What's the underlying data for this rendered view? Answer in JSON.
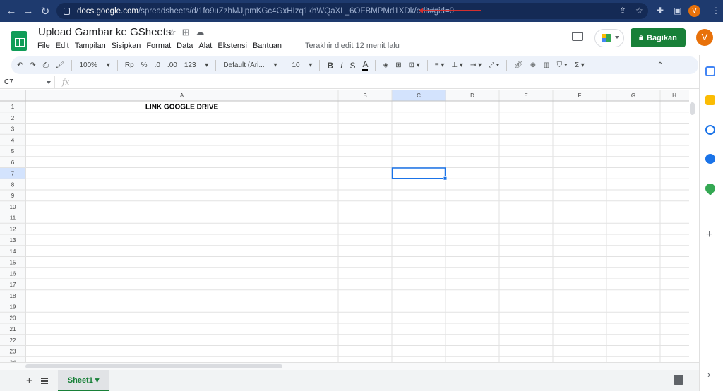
{
  "browser": {
    "url_host": "docs.google.com",
    "url_path": "/spreadsheets/d/1fo9uZzhMJjpmKGc4GxHIzq1khWQaXL_6OFBMPMd1XDk/edit#gid=0",
    "profile_initial": "V"
  },
  "doc": {
    "title": "Upload Gambar ke GSheets",
    "last_edit": "Terakhir diedit 12 menit lalu",
    "share_label": "Bagikan",
    "user_initial": "V"
  },
  "menu": [
    "File",
    "Edit",
    "Tampilan",
    "Sisipkan",
    "Format",
    "Data",
    "Alat",
    "Ekstensi",
    "Bantuan"
  ],
  "toolbar": {
    "zoom": "100%",
    "currency": "Rp",
    "percent": "%",
    "dec_decrease": ".0",
    "dec_increase": ".00",
    "more_formats": "123",
    "font": "Default (Ari...",
    "font_size": "10"
  },
  "formula_bar": {
    "cell_ref": "C7",
    "fx": "fx",
    "content": ""
  },
  "columns": [
    "A",
    "B",
    "C",
    "D",
    "E",
    "F",
    "G",
    "H"
  ],
  "rows": [
    "1",
    "2",
    "3",
    "4",
    "5",
    "6",
    "7",
    "8",
    "9",
    "10",
    "11",
    "12",
    "13",
    "14",
    "15",
    "16",
    "17",
    "18",
    "19",
    "20",
    "21",
    "22",
    "23",
    "24"
  ],
  "cells": {
    "A1": "LINK GOOGLE DRIVE"
  },
  "selected_cell": "C7",
  "sheet_tab": "Sheet1",
  "colors": {
    "accent": "#188038",
    "selection": "#1a73e8",
    "browser": "#1e3a6e"
  }
}
